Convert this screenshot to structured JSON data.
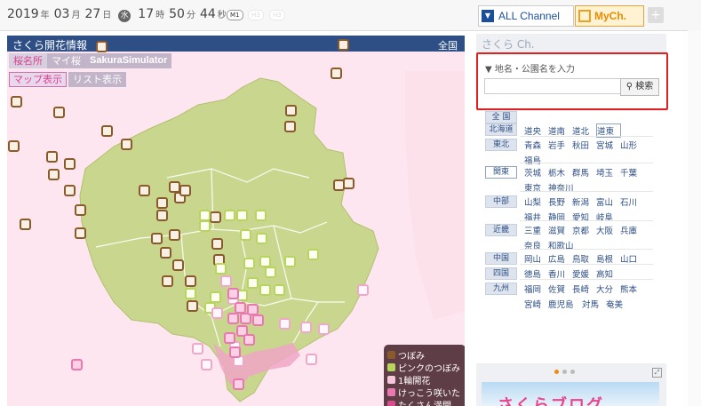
{
  "header": {
    "year": "2019",
    "year_unit": "年",
    "month": "03",
    "month_unit": "月",
    "day": "27",
    "day_unit": "日",
    "weekday": "水",
    "hour": "17",
    "hour_unit": "時",
    "minute": "50",
    "minute_unit": "分",
    "second": "44",
    "second_unit": "秒",
    "modes": [
      "M1",
      "H3",
      "H3"
    ]
  },
  "tabs": {
    "all_channel": "ALL Channel",
    "my_channel": "MyCh.",
    "add": "+"
  },
  "map": {
    "title": "さくら開花情報",
    "zone_button": "全国",
    "nav": [
      "桜名所",
      "マイ桜",
      "SakuraSimulator"
    ],
    "views": [
      "マップ表示",
      "リスト表示"
    ],
    "legend": [
      {
        "label": "つぼみ",
        "color": "#8a5a2a"
      },
      {
        "label": "ピンクのつぼみ",
        "color": "#b7d45c"
      },
      {
        "label": "1輪開花",
        "color": "#f7c6da"
      },
      {
        "label": "けっこう咲いた",
        "color": "#e978ae"
      },
      {
        "label": "たくさん満開",
        "color": "#d94d8f"
      }
    ]
  },
  "sidebar": {
    "title": "さくら Ch.",
    "search_label": "▼ 地名・公園名を入力",
    "search_placeholder": "",
    "search_button": "検索",
    "regions": [
      {
        "name": "全 国",
        "prefs": []
      },
      {
        "name": "北海道",
        "prefs": [
          "道央",
          "道南",
          "道北",
          "道東"
        ]
      },
      {
        "name": "東北",
        "prefs": [
          "青森",
          "岩手",
          "秋田",
          "宮城",
          "山形",
          "福島"
        ]
      },
      {
        "name": "関東",
        "prefs": [
          "茨城",
          "栃木",
          "群馬",
          "埼玉",
          "千葉",
          "東京",
          "神奈川"
        ]
      },
      {
        "name": "中部",
        "prefs": [
          "山梨",
          "長野",
          "新潟",
          "富山",
          "石川",
          "福井",
          "静岡",
          "愛知",
          "岐阜"
        ]
      },
      {
        "name": "近畿",
        "prefs": [
          "三重",
          "滋賀",
          "京都",
          "大阪",
          "兵庫",
          "奈良",
          "和歌山"
        ]
      },
      {
        "name": "中国",
        "prefs": [
          "岡山",
          "広島",
          "鳥取",
          "島根",
          "山口"
        ]
      },
      {
        "name": "四国",
        "prefs": [
          "徳島",
          "香川",
          "愛媛",
          "高知"
        ]
      },
      {
        "name": "九州",
        "prefs": [
          "福岡",
          "佐賀",
          "長崎",
          "大分",
          "熊本",
          "宮崎",
          "鹿児島",
          "対馬",
          "奄美"
        ]
      }
    ],
    "banner_text": "さくらブログ"
  }
}
